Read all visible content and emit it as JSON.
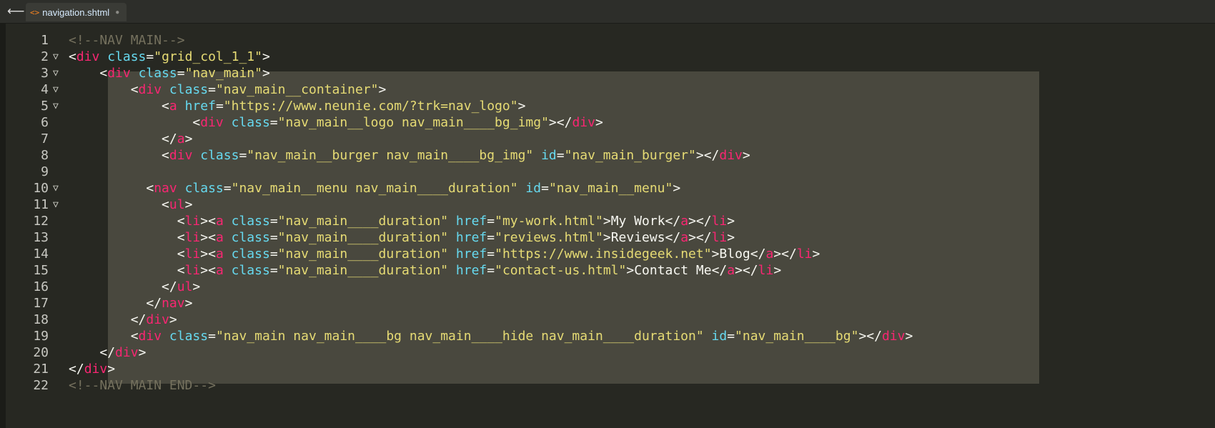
{
  "tab": {
    "back_glyph": "⟵",
    "icon_glyph": "<>",
    "filename": "navigation.shtml",
    "dirty_glyph": "●"
  },
  "editor": {
    "lines": [
      {
        "num": "1",
        "fold": "",
        "indent": "",
        "tokens": [
          [
            "<!--NAV MAIN-->",
            "comment"
          ]
        ]
      },
      {
        "num": "2",
        "fold": "▽",
        "indent": "",
        "tokens": [
          [
            "<",
            "pun"
          ],
          [
            "div",
            "tag"
          ],
          [
            " ",
            "text"
          ],
          [
            "class",
            "attr"
          ],
          [
            "=",
            "pun"
          ],
          [
            "\"grid_col_1_1\"",
            "str"
          ],
          [
            ">",
            "pun"
          ]
        ]
      },
      {
        "num": "3",
        "fold": "▽",
        "indent": "    ",
        "tokens": [
          [
            "<",
            "pun"
          ],
          [
            "div",
            "tag"
          ],
          [
            " ",
            "text"
          ],
          [
            "class",
            "attr"
          ],
          [
            "=",
            "pun"
          ],
          [
            "\"nav_main\"",
            "str"
          ],
          [
            ">",
            "pun"
          ]
        ]
      },
      {
        "num": "4",
        "fold": "▽",
        "indent": "        ",
        "tokens": [
          [
            "<",
            "pun"
          ],
          [
            "div",
            "tag"
          ],
          [
            " ",
            "text"
          ],
          [
            "class",
            "attr"
          ],
          [
            "=",
            "pun"
          ],
          [
            "\"nav_main__container\"",
            "str"
          ],
          [
            ">",
            "pun"
          ]
        ]
      },
      {
        "num": "5",
        "fold": "▽",
        "indent": "            ",
        "tokens": [
          [
            "<",
            "pun"
          ],
          [
            "a",
            "tag"
          ],
          [
            " ",
            "text"
          ],
          [
            "href",
            "attr"
          ],
          [
            "=",
            "pun"
          ],
          [
            "\"https://www.neunie.com/?trk=nav_logo\"",
            "str"
          ],
          [
            ">",
            "pun"
          ]
        ]
      },
      {
        "num": "6",
        "fold": "",
        "indent": "                ",
        "tokens": [
          [
            "<",
            "pun"
          ],
          [
            "div",
            "tag"
          ],
          [
            " ",
            "text"
          ],
          [
            "class",
            "attr"
          ],
          [
            "=",
            "pun"
          ],
          [
            "\"nav_main__logo nav_main____bg_img\"",
            "str"
          ],
          [
            "></",
            "pun"
          ],
          [
            "div",
            "tag"
          ],
          [
            ">",
            "pun"
          ]
        ]
      },
      {
        "num": "7",
        "fold": "",
        "indent": "            ",
        "tokens": [
          [
            "</",
            "pun"
          ],
          [
            "a",
            "tag"
          ],
          [
            ">",
            "pun"
          ]
        ]
      },
      {
        "num": "8",
        "fold": "",
        "indent": "            ",
        "tokens": [
          [
            "<",
            "pun"
          ],
          [
            "div",
            "tag"
          ],
          [
            " ",
            "text"
          ],
          [
            "class",
            "attr"
          ],
          [
            "=",
            "pun"
          ],
          [
            "\"nav_main__burger nav_main____bg_img\"",
            "str"
          ],
          [
            " ",
            "text"
          ],
          [
            "id",
            "attr"
          ],
          [
            "=",
            "pun"
          ],
          [
            "\"nav_main_burger\"",
            "str"
          ],
          [
            "></",
            "pun"
          ],
          [
            "div",
            "tag"
          ],
          [
            ">",
            "pun"
          ]
        ]
      },
      {
        "num": "9",
        "fold": "",
        "indent": "",
        "tokens": []
      },
      {
        "num": "10",
        "fold": "▽",
        "indent": "          ",
        "tokens": [
          [
            "<",
            "pun"
          ],
          [
            "nav",
            "tag"
          ],
          [
            " ",
            "text"
          ],
          [
            "class",
            "attr"
          ],
          [
            "=",
            "pun"
          ],
          [
            "\"nav_main__menu nav_main____duration\"",
            "str"
          ],
          [
            " ",
            "text"
          ],
          [
            "id",
            "attr"
          ],
          [
            "=",
            "pun"
          ],
          [
            "\"nav_main__menu\"",
            "str"
          ],
          [
            ">",
            "pun"
          ]
        ]
      },
      {
        "num": "11",
        "fold": "▽",
        "indent": "            ",
        "tokens": [
          [
            "<",
            "pun"
          ],
          [
            "ul",
            "tag"
          ],
          [
            ">",
            "pun"
          ]
        ]
      },
      {
        "num": "12",
        "fold": "",
        "indent": "              ",
        "tokens": [
          [
            "<",
            "pun"
          ],
          [
            "li",
            "tag"
          ],
          [
            "><",
            "pun"
          ],
          [
            "a",
            "tag"
          ],
          [
            " ",
            "text"
          ],
          [
            "class",
            "attr"
          ],
          [
            "=",
            "pun"
          ],
          [
            "\"nav_main____duration\"",
            "str"
          ],
          [
            " ",
            "text"
          ],
          [
            "href",
            "attr"
          ],
          [
            "=",
            "pun"
          ],
          [
            "\"my-work.html\"",
            "str"
          ],
          [
            ">",
            "pun"
          ],
          [
            "My Work",
            "text"
          ],
          [
            "</",
            "pun"
          ],
          [
            "a",
            "tag"
          ],
          [
            "></",
            "pun"
          ],
          [
            "li",
            "tag"
          ],
          [
            ">",
            "pun"
          ]
        ]
      },
      {
        "num": "13",
        "fold": "",
        "indent": "              ",
        "tokens": [
          [
            "<",
            "pun"
          ],
          [
            "li",
            "tag"
          ],
          [
            "><",
            "pun"
          ],
          [
            "a",
            "tag"
          ],
          [
            " ",
            "text"
          ],
          [
            "class",
            "attr"
          ],
          [
            "=",
            "pun"
          ],
          [
            "\"nav_main____duration\"",
            "str"
          ],
          [
            " ",
            "text"
          ],
          [
            "href",
            "attr"
          ],
          [
            "=",
            "pun"
          ],
          [
            "\"reviews.html\"",
            "str"
          ],
          [
            ">",
            "pun"
          ],
          [
            "Reviews",
            "text"
          ],
          [
            "</",
            "pun"
          ],
          [
            "a",
            "tag"
          ],
          [
            "></",
            "pun"
          ],
          [
            "li",
            "tag"
          ],
          [
            ">",
            "pun"
          ]
        ]
      },
      {
        "num": "14",
        "fold": "",
        "indent": "              ",
        "tokens": [
          [
            "<",
            "pun"
          ],
          [
            "li",
            "tag"
          ],
          [
            "><",
            "pun"
          ],
          [
            "a",
            "tag"
          ],
          [
            " ",
            "text"
          ],
          [
            "class",
            "attr"
          ],
          [
            "=",
            "pun"
          ],
          [
            "\"nav_main____duration\"",
            "str"
          ],
          [
            " ",
            "text"
          ],
          [
            "href",
            "attr"
          ],
          [
            "=",
            "pun"
          ],
          [
            "\"https://www.insidegeek.net\"",
            "str"
          ],
          [
            ">",
            "pun"
          ],
          [
            "Blog",
            "text"
          ],
          [
            "</",
            "pun"
          ],
          [
            "a",
            "tag"
          ],
          [
            "></",
            "pun"
          ],
          [
            "li",
            "tag"
          ],
          [
            ">",
            "pun"
          ]
        ]
      },
      {
        "num": "15",
        "fold": "",
        "indent": "              ",
        "tokens": [
          [
            "<",
            "pun"
          ],
          [
            "li",
            "tag"
          ],
          [
            "><",
            "pun"
          ],
          [
            "a",
            "tag"
          ],
          [
            " ",
            "text"
          ],
          [
            "class",
            "attr"
          ],
          [
            "=",
            "pun"
          ],
          [
            "\"nav_main____duration\"",
            "str"
          ],
          [
            " ",
            "text"
          ],
          [
            "href",
            "attr"
          ],
          [
            "=",
            "pun"
          ],
          [
            "\"contact-us.html\"",
            "str"
          ],
          [
            ">",
            "pun"
          ],
          [
            "Contact Me",
            "text"
          ],
          [
            "</",
            "pun"
          ],
          [
            "a",
            "tag"
          ],
          [
            "></",
            "pun"
          ],
          [
            "li",
            "tag"
          ],
          [
            ">",
            "pun"
          ]
        ]
      },
      {
        "num": "16",
        "fold": "",
        "indent": "            ",
        "tokens": [
          [
            "</",
            "pun"
          ],
          [
            "ul",
            "tag"
          ],
          [
            ">",
            "pun"
          ]
        ]
      },
      {
        "num": "17",
        "fold": "",
        "indent": "          ",
        "tokens": [
          [
            "</",
            "pun"
          ],
          [
            "nav",
            "tag"
          ],
          [
            ">",
            "pun"
          ]
        ]
      },
      {
        "num": "18",
        "fold": "",
        "indent": "        ",
        "tokens": [
          [
            "</",
            "pun"
          ],
          [
            "div",
            "tag"
          ],
          [
            ">",
            "pun"
          ]
        ]
      },
      {
        "num": "19",
        "fold": "",
        "indent": "        ",
        "tokens": [
          [
            "<",
            "pun"
          ],
          [
            "div",
            "tag"
          ],
          [
            " ",
            "text"
          ],
          [
            "class",
            "attr"
          ],
          [
            "=",
            "pun"
          ],
          [
            "\"nav_main nav_main____bg nav_main____hide nav_main____duration\"",
            "str"
          ],
          [
            " ",
            "text"
          ],
          [
            "id",
            "attr"
          ],
          [
            "=",
            "pun"
          ],
          [
            "\"nav_main____bg\"",
            "str"
          ],
          [
            "></",
            "pun"
          ],
          [
            "div",
            "tag"
          ],
          [
            ">",
            "pun"
          ]
        ]
      },
      {
        "num": "20",
        "fold": "",
        "indent": "    ",
        "tokens": [
          [
            "</",
            "pun"
          ],
          [
            "div",
            "tag"
          ],
          [
            ">",
            "pun"
          ]
        ]
      },
      {
        "num": "21",
        "fold": "",
        "indent": "",
        "tokens": [
          [
            "</",
            "pun"
          ],
          [
            "div",
            "tag"
          ],
          [
            ">",
            "pun"
          ]
        ]
      },
      {
        "num": "22",
        "fold": "",
        "indent": "",
        "tokens": [
          [
            "<!--NAV MAIN END-->",
            "comment"
          ]
        ]
      }
    ]
  },
  "colors": {
    "background": "#272822",
    "selection": "#49483e",
    "tag": "#f92672",
    "attribute": "#66d9ef",
    "string": "#e6db74",
    "comment": "#75715e",
    "text": "#f8f8f2",
    "tab_icon": "#f58220"
  }
}
